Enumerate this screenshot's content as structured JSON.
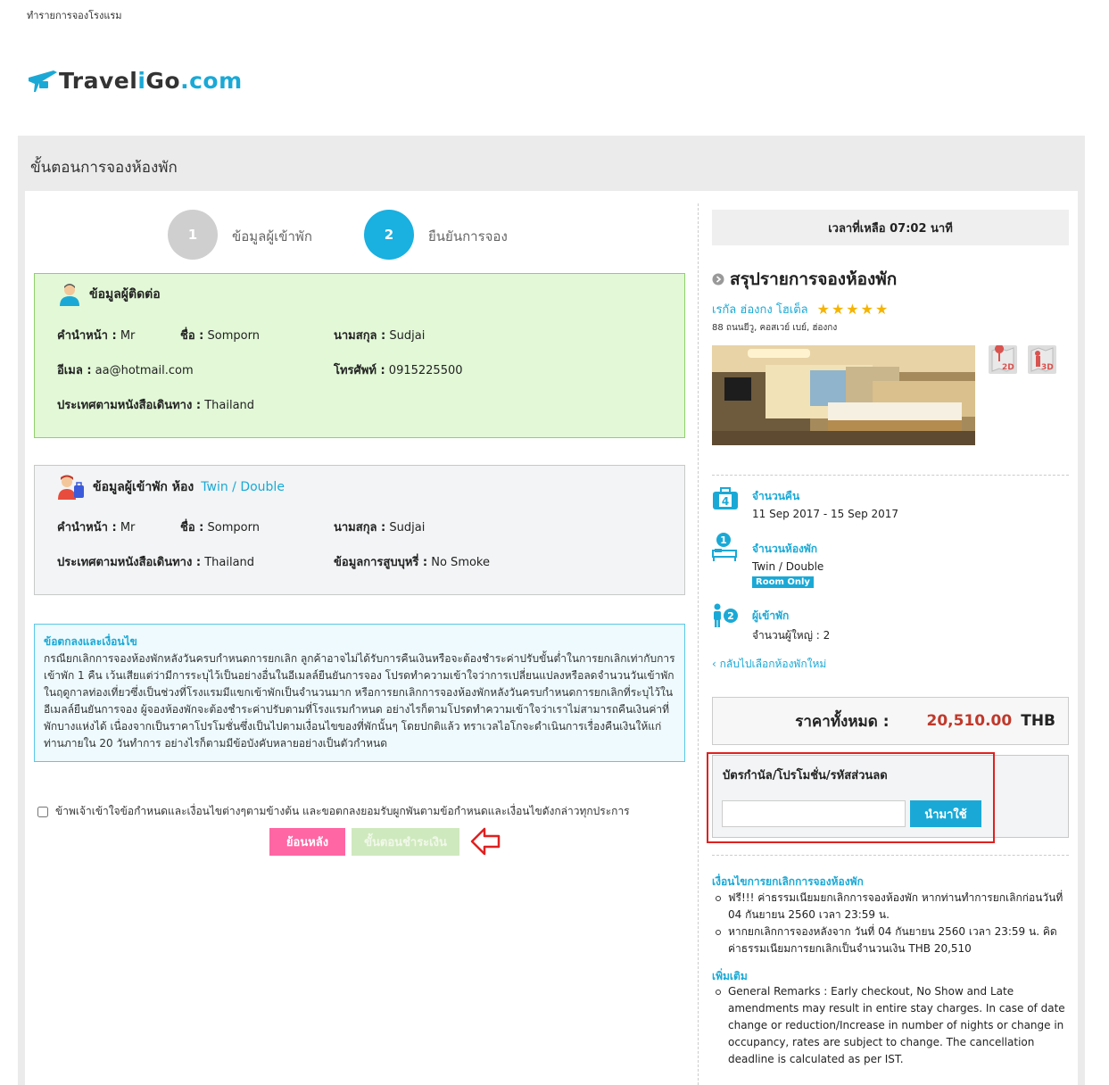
{
  "breadcrumb": "ทำรายการจองโรงแรม",
  "logo": {
    "part1": "Travel",
    "part2": "i",
    "part3": "Go",
    "part4": ".com"
  },
  "page_title": "ขั้นตอนการจองห้องพัก",
  "steps": [
    {
      "number": "1",
      "label": "ข้อมูลผู้เข้าพัก",
      "color": "#cfcfcf"
    },
    {
      "number": "2",
      "label": "ยืนยันการจอง",
      "color": "#1ab0e0"
    }
  ],
  "contact": {
    "heading": "ข้อมูลผู้ติดต่อ",
    "title_label": "คำนำหน้า :",
    "title_value": "Mr",
    "first_label": "ชื่อ :",
    "first_value": "Somporn",
    "last_label": "นามสกุล :",
    "last_value": "Sudjai",
    "email_label": "อีเมล :",
    "email_value": "aa@hotmail.com",
    "phone_label": "โทรศัพท์ :",
    "phone_value": "0915225500",
    "country_label": "ประเทศตามหนังสือเดินทาง :",
    "country_value": "Thailand"
  },
  "guest": {
    "heading": "ข้อมูลผู้เข้าพัก ห้อง",
    "room": "Twin / Double",
    "title_label": "คำนำหน้า :",
    "title_value": "Mr",
    "first_label": "ชื่อ :",
    "first_value": "Somporn",
    "last_label": "นามสกุล :",
    "last_value": "Sudjai",
    "country_label": "ประเทศตามหนังสือเดินทาง :",
    "country_value": "Thailand",
    "smoke_label": "ข้อมูลการสูบบุหรี่ :",
    "smoke_value": "No Smoke"
  },
  "terms": {
    "title": "ข้อตกลงและเงื่อนไข",
    "body": "กรณียกเลิกการจองห้องพักหลังวันครบกำหนดการยกเลิก ลูกค้าอาจไม่ได้รับการคืนเงินหรือจะต้องชำระค่าปรับขั้นต่ำในการยกเลิกเท่ากับการเข้าพัก 1 คืน เว้นเสียแต่ว่ามีการระบุไว้เป็นอย่างอื่นในอีเมลล์ยืนยันการจอง โปรดทำความเข้าใจว่าการเปลี่ยนแปลงหรือลดจำนวนวันเข้าพักในฤดูกาลท่องเที่ยวซึ่งเป็นช่วงที่โรงแรมมีแขกเข้าพักเป็นจำนวนมาก หรือการยกเลิกการจองห้องพักหลังวันครบกำหนดการยกเลิกที่ระบุไว้ในอีเมลล์ยืนยันการจอง ผู้จองห้องพักจะต้องชำระค่าปรับตามที่โรงแรมกำหนด อย่างไรก็ตามโปรดทำความเข้าใจว่าเราไม่สามารถคืนเงินค่าที่พักบางแห่งได้ เนื่องจากเป็นราคาโปรโมชั่นซึ่งเป็นไปตามเงื่อนไขของที่พักนั้นๆ โดยปกติแล้ว ทราเวลไอโกจะดำเนินการเรื่องคืนเงินให้แก่ท่านภายใน 20 วันทำการ อย่างไรก็ตามมีข้อบังคับหลายอย่างเป็นตัวกำหนด"
  },
  "agree_text": "ข้าพเจ้าเข้าใจข้อกำหนดและเงื่อนไขต่างๆตามข้างต้น และขอตกลงยอมรับผูกพันตามข้อกำหนดและเงื่อนไขดังกล่าวทุกประการ",
  "buttons": {
    "back": "ย้อนหลัง",
    "pay": "ขั้นตอนชำระเงิน"
  },
  "timer": "เวลาที่เหลือ 07:02 นาที",
  "summary": {
    "title": "สรุปรายการจองห้องพัก",
    "hotel_name": "เรกัล ฮ่องกง โฮเต็ล",
    "stars": "★★★★★",
    "address": "88 ถนนยีวู, คอสเวย์ เบย์, ฮ่องกง",
    "map_2d": "2D",
    "map_3d": "3D",
    "nights_icon_num": "4",
    "nights_label": "จำนวนคืน",
    "nights_value": "11 Sep 2017 - 15 Sep 2017",
    "rooms_icon_num": "1",
    "rooms_label": "จำนวนห้องพัก",
    "rooms_value": "Twin / Double",
    "room_badge": "Room Only",
    "guests_icon_num": "2",
    "guests_label": "ผู้เข้าพัก",
    "guests_value": "จำนวนผู้ใหญ่ : 2",
    "back_link": "กลับไปเลือกห้องพักใหม่"
  },
  "total": {
    "label": "ราคาทั้งหมด :",
    "amount": "20,510.00",
    "currency": "THB"
  },
  "promo": {
    "title": "บัตรกำนัล/โปรโมชั่น/รหัสส่วนลด",
    "input_value": "",
    "button": "นำมาใช้"
  },
  "cancel": {
    "title": "เงื่อนไขการยกเลิกการจองห้องพัก",
    "items": [
      "ฟรี!!! ค่าธรรมเนียมยกเลิกการจองห้องพัก หากท่านทำการยกเลิกก่อนวันที่ 04 กันยายน 2560 เวลา 23:59 น.",
      "หากยกเลิกการจองหลังจาก วันที่ 04 กันยายน 2560 เวลา 23:59 น. คิดค่าธรรมเนียมการยกเลิกเป็นจำนวนเงิน THB 20,510"
    ]
  },
  "extra": {
    "title": "เพิ่มเติม",
    "items": [
      "General Remarks : Early checkout, No Show and Late amendments may result in entire stay charges. In case of date change or reduction/Increase in number of nights or change in occupancy, rates are subject to change. The cancellation deadline is calculated as per IST."
    ]
  }
}
